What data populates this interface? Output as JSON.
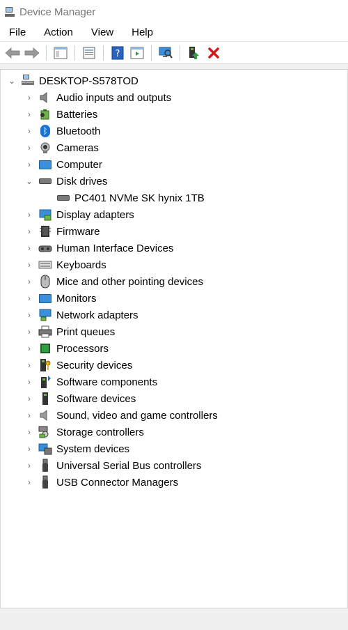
{
  "window": {
    "title": "Device Manager"
  },
  "menu": [
    "File",
    "Action",
    "View",
    "Help"
  ],
  "tree": {
    "root": "DESKTOP-S578TOD",
    "categories": [
      {
        "label": "Audio inputs and outputs",
        "icon": "speaker-icon"
      },
      {
        "label": "Batteries",
        "icon": "battery-icon"
      },
      {
        "label": "Bluetooth",
        "icon": "bluetooth-icon"
      },
      {
        "label": "Cameras",
        "icon": "camera-icon"
      },
      {
        "label": "Computer",
        "icon": "computer-icon"
      },
      {
        "label": "Disk drives",
        "icon": "disk-drive-icon",
        "expanded": true,
        "children": [
          {
            "label": "PC401 NVMe SK hynix 1TB",
            "icon": "disk-drive-icon"
          }
        ]
      },
      {
        "label": "Display adapters",
        "icon": "display-adapter-icon"
      },
      {
        "label": "Firmware",
        "icon": "firmware-icon"
      },
      {
        "label": "Human Interface Devices",
        "icon": "hid-icon"
      },
      {
        "label": "Keyboards",
        "icon": "keyboard-icon"
      },
      {
        "label": "Mice and other pointing devices",
        "icon": "mouse-icon"
      },
      {
        "label": "Monitors",
        "icon": "monitor-icon"
      },
      {
        "label": "Network adapters",
        "icon": "network-adapter-icon"
      },
      {
        "label": "Print queues",
        "icon": "printer-icon"
      },
      {
        "label": "Processors",
        "icon": "processor-icon"
      },
      {
        "label": "Security devices",
        "icon": "security-device-icon"
      },
      {
        "label": "Software components",
        "icon": "software-component-icon"
      },
      {
        "label": "Software devices",
        "icon": "software-device-icon"
      },
      {
        "label": "Sound, video and game controllers",
        "icon": "sound-controller-icon"
      },
      {
        "label": "Storage controllers",
        "icon": "storage-controller-icon"
      },
      {
        "label": "System devices",
        "icon": "system-device-icon"
      },
      {
        "label": "Universal Serial Bus controllers",
        "icon": "usb-icon"
      },
      {
        "label": "USB Connector Managers",
        "icon": "usb-connector-icon"
      }
    ]
  },
  "colors": {
    "accent": "#1b74d1",
    "delete": "#d11b1b",
    "enable": "#2f9e44"
  }
}
